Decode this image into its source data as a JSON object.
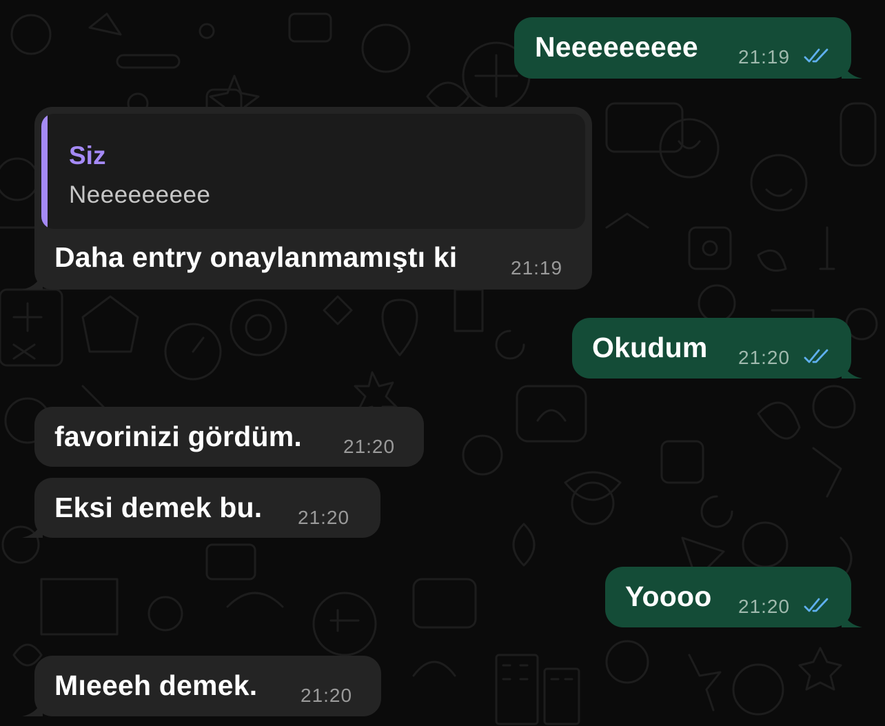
{
  "chat": {
    "messages": [
      {
        "direction": "outgoing",
        "text": "Neeeeeeeee",
        "time": "21:19",
        "status": "read"
      },
      {
        "direction": "incoming",
        "reply_to": {
          "author": "Siz",
          "text": "Neeeeeeeee"
        },
        "text": "Daha entry onaylanmamıştı ki",
        "time": "21:19"
      },
      {
        "direction": "outgoing",
        "text": "Okudum",
        "time": "21:20",
        "status": "read"
      },
      {
        "direction": "incoming",
        "text": "favorinizi gördüm.",
        "time": "21:20"
      },
      {
        "direction": "incoming",
        "text": "Eksi demek bu.",
        "time": "21:20"
      },
      {
        "direction": "outgoing",
        "text": "Yoooo",
        "time": "21:20",
        "status": "read"
      },
      {
        "direction": "incoming",
        "text": "Mıeeeh demek.",
        "time": "21:20"
      }
    ]
  },
  "colors": {
    "background": "#0b0b0b",
    "incoming_bubble": "#242424",
    "outgoing_bubble": "#144c37",
    "quote_accent": "#a58af6",
    "read_ticks": "#5fb0ef"
  }
}
